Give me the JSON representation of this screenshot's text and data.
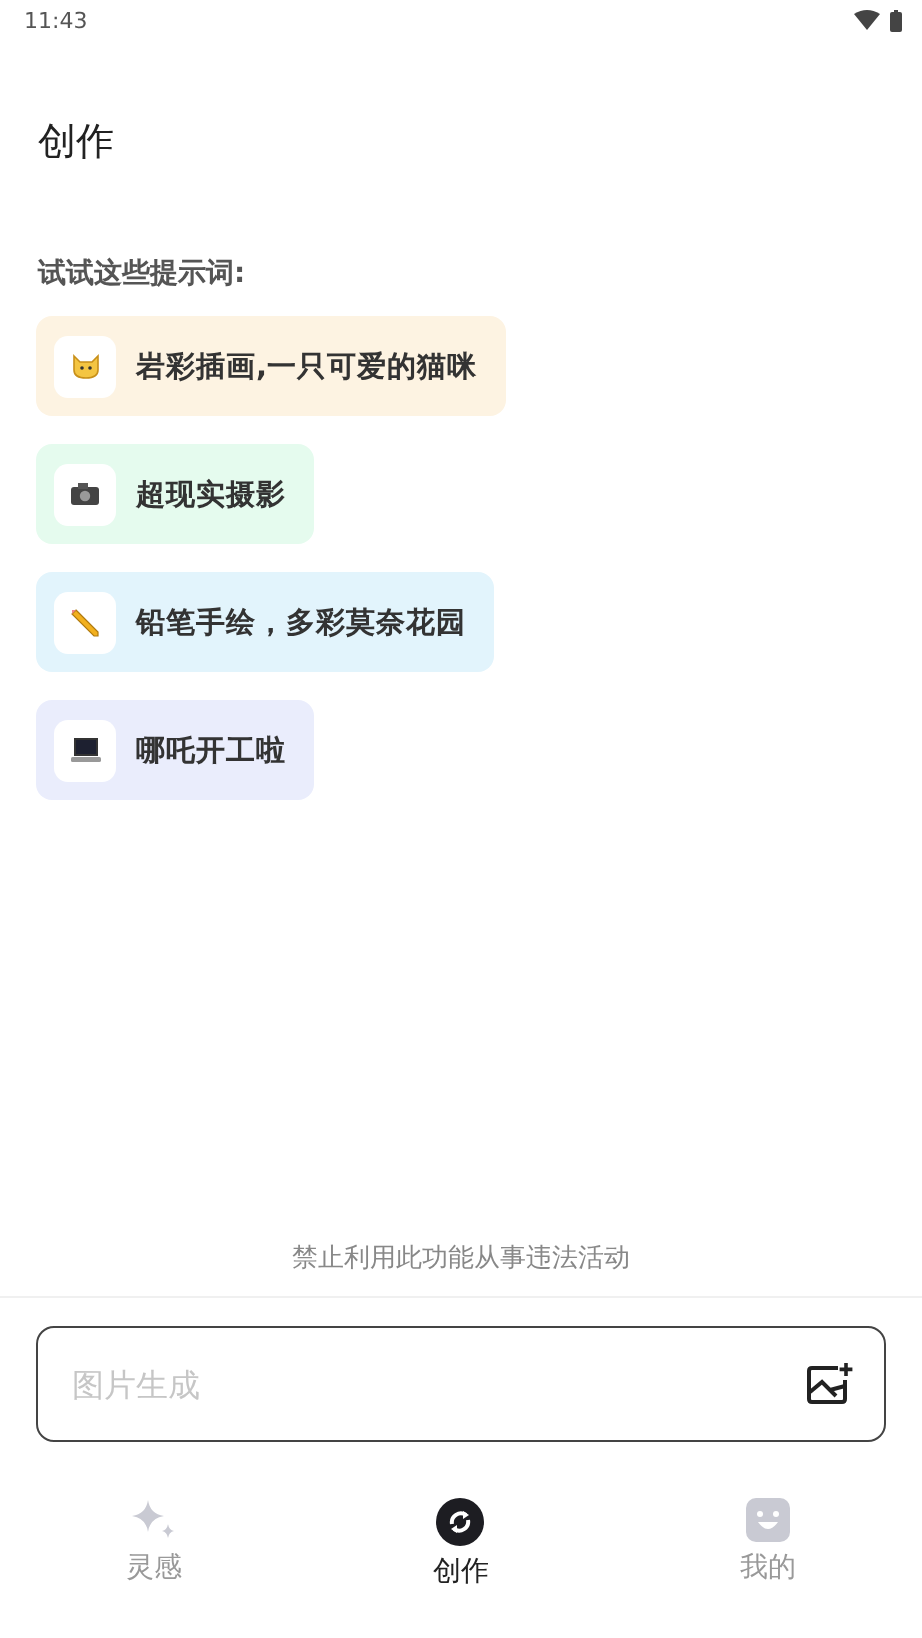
{
  "status_bar": {
    "time": "11:43"
  },
  "title": "创作",
  "prompts_label": "试试这些提示词:",
  "prompts": [
    {
      "kind": "cat",
      "text": "岩彩插画,一只可爱的猫咪",
      "color": "#fdf3e2"
    },
    {
      "kind": "camera",
      "text": "超现实摄影",
      "color": "#e5fbee"
    },
    {
      "kind": "pencil",
      "text": "铅笔手绘，多彩莫奈花园",
      "color": "#e2f4fc"
    },
    {
      "kind": "laptop",
      "text": "哪吒开工啦",
      "color": "#eaedfc"
    }
  ],
  "notice": "禁止利用此功能从事违法活动",
  "input": {
    "placeholder": "图片生成"
  },
  "nav": [
    {
      "kind": "sparkle",
      "label": "灵感",
      "selected": false
    },
    {
      "kind": "create",
      "label": "创作",
      "selected": true
    },
    {
      "kind": "face",
      "label": "我的",
      "selected": false
    }
  ]
}
